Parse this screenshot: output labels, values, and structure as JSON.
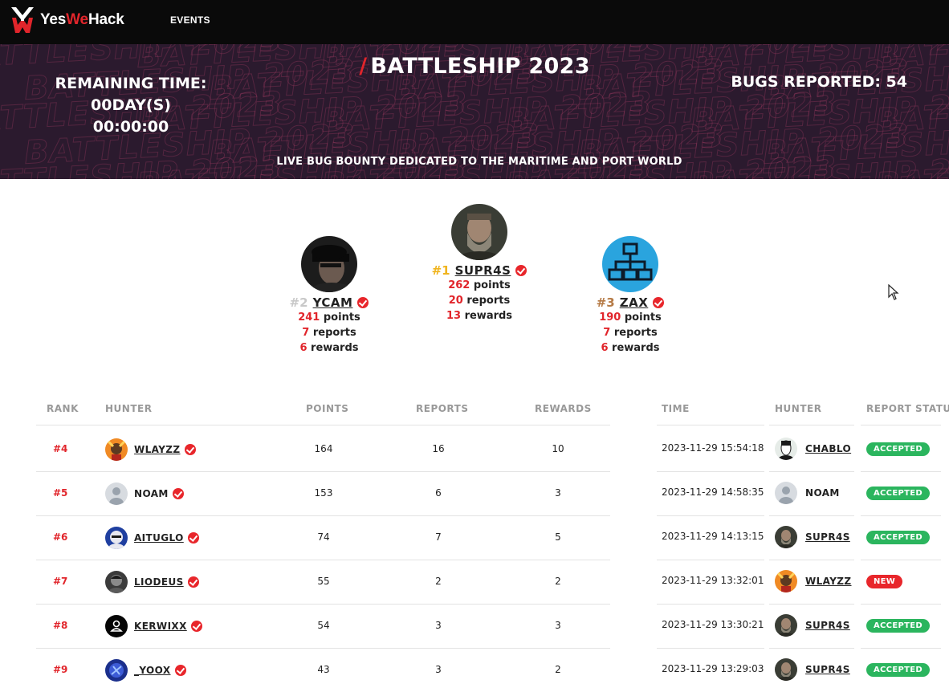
{
  "nav": {
    "brand": {
      "part1": "Yes",
      "part2": "We",
      "part3": "Hack"
    },
    "events_label": "EVENTS"
  },
  "banner": {
    "title": "BATTLESHIP 2023",
    "title_prefix": "/",
    "remaining_label": "REMAINING TIME: 00DAY(S)",
    "remaining_time": "00:00:00",
    "bugs_reported": "BUGS REPORTED: 54",
    "tagline": "LIVE BUG BOUNTY DEDICATED TO THE MARITIME AND PORT WORLD",
    "watermark": "BATTLESHIP 2023"
  },
  "podium": [
    {
      "rank": "#2",
      "name": "YCAM",
      "points": "241",
      "reports": "7",
      "rewards": "6",
      "rank_color": "#c8c8c8"
    },
    {
      "rank": "#1",
      "name": "SUPR4S",
      "points": "262",
      "reports": "20",
      "rewards": "13",
      "rank_color": "#f0b41e"
    },
    {
      "rank": "#3",
      "name": "ZAX",
      "points": "190",
      "reports": "7",
      "rewards": "6",
      "rank_color": "#b57a45"
    }
  ],
  "stat_labels": {
    "points": "points",
    "reports": "reports",
    "rewards": "rewards"
  },
  "leaderboard": {
    "headers": [
      "RANK",
      "HUNTER",
      "POINTS",
      "REPORTS",
      "REWARDS"
    ],
    "rows": [
      {
        "rank": "#4",
        "hunter": "WLAYZZ",
        "verified": true,
        "points": "164",
        "reports": "16",
        "rewards": "10"
      },
      {
        "rank": "#5",
        "hunter": "NOAM",
        "verified": true,
        "points": "153",
        "reports": "6",
        "rewards": "3"
      },
      {
        "rank": "#6",
        "hunter": "AITUGLO",
        "verified": true,
        "points": "74",
        "reports": "7",
        "rewards": "5"
      },
      {
        "rank": "#7",
        "hunter": "LIODEUS",
        "verified": true,
        "points": "55",
        "reports": "2",
        "rewards": "2"
      },
      {
        "rank": "#8",
        "hunter": "KERWIXX",
        "verified": true,
        "points": "54",
        "reports": "3",
        "rewards": "3"
      },
      {
        "rank": "#9",
        "hunter": "_YOOX",
        "verified": true,
        "points": "43",
        "reports": "3",
        "rewards": "2"
      }
    ]
  },
  "activity": {
    "headers": [
      "TIME",
      "HUNTER",
      "REPORT STATUS"
    ],
    "rows": [
      {
        "time": "2023-11-29 15:54:18",
        "hunter": "CHABLO",
        "status": "ACCEPTED"
      },
      {
        "time": "2023-11-29 14:58:35",
        "hunter": "NOAM",
        "status": "ACCEPTED"
      },
      {
        "time": "2023-11-29 14:13:15",
        "hunter": "SUPR4S",
        "status": "ACCEPTED"
      },
      {
        "time": "2023-11-29 13:32:01",
        "hunter": "WLAYZZ",
        "status": "NEW"
      },
      {
        "time": "2023-11-29 13:30:21",
        "hunter": "SUPR4S",
        "status": "ACCEPTED"
      },
      {
        "time": "2023-11-29 13:29:03",
        "hunter": "SUPR4S",
        "status": "ACCEPTED"
      }
    ]
  },
  "colors": {
    "accent_red": "#e1252b",
    "accepted_green": "#2bb55e",
    "new_red": "#e8262b",
    "banner_bg": "#2b1a2e"
  }
}
